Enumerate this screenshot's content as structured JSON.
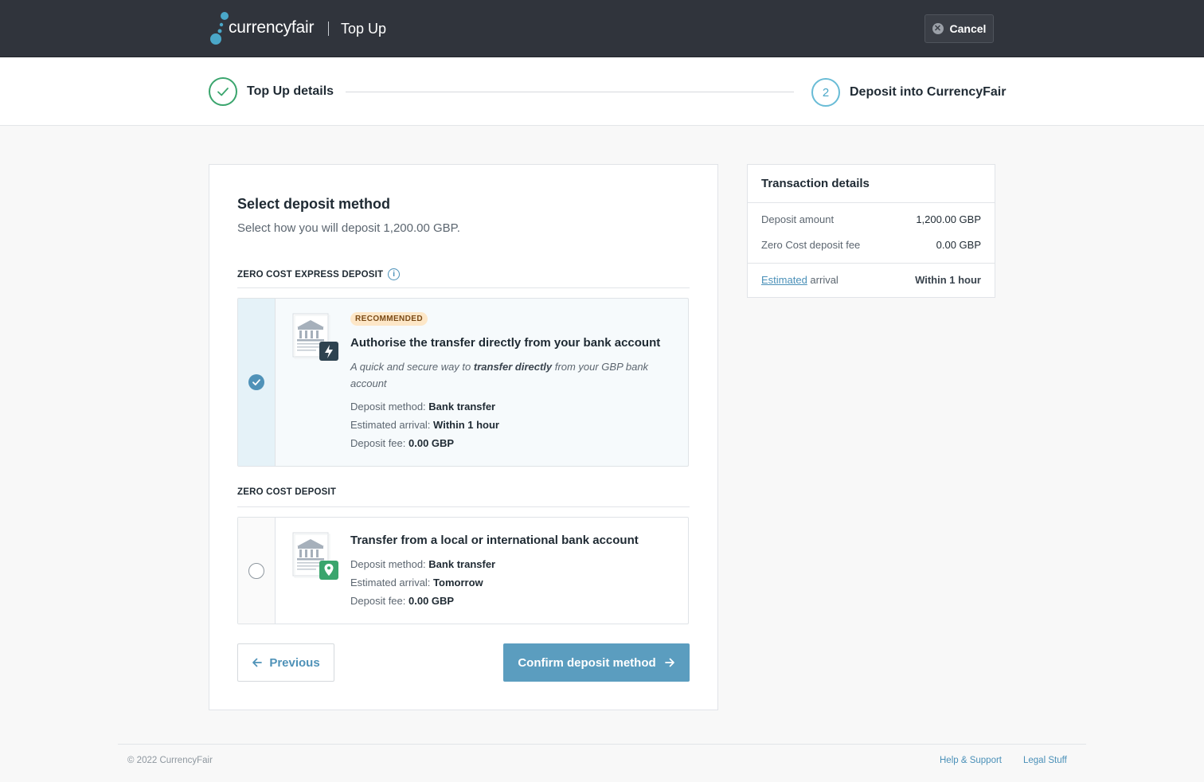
{
  "header": {
    "logo_text": "currencyfair",
    "app_title": "Top Up",
    "cancel_label": "Cancel"
  },
  "stepper": {
    "step1_label": "Top Up details",
    "step2_number": "2",
    "step2_label": "Deposit into CurrencyFair"
  },
  "main": {
    "title": "Select deposit method",
    "subtitle": "Select how you will deposit 1,200.00 GBP.",
    "sections": [
      {
        "heading": "ZERO COST EXPRESS DEPOSIT",
        "option": {
          "selected": true,
          "badge": "RECOMMENDED",
          "title": "Authorise the transfer directly from your bank account",
          "desc_prefix": "A quick and secure way to ",
          "desc_bold": "transfer directly",
          "desc_suffix": " from your GBP bank account",
          "method_label": "Deposit method:",
          "method_value": "Bank transfer",
          "arrival_label": "Estimated arrival:",
          "arrival_value": "Within 1 hour",
          "fee_label": "Deposit fee:",
          "fee_value": "0.00 GBP",
          "icon": "bank-lightning-icon"
        }
      },
      {
        "heading": "ZERO COST DEPOSIT",
        "option": {
          "selected": false,
          "title": "Transfer from a local or international bank account",
          "method_label": "Deposit method:",
          "method_value": "Bank transfer",
          "arrival_label": "Estimated arrival:",
          "arrival_value": "Tomorrow",
          "fee_label": "Deposit fee:",
          "fee_value": "0.00 GBP",
          "icon": "bank-location-icon"
        }
      }
    ],
    "previous_label": "Previous",
    "confirm_label": "Confirm deposit method"
  },
  "transaction": {
    "title": "Transaction details",
    "deposit_amount_label": "Deposit amount",
    "deposit_amount_value": "1,200.00 GBP",
    "fee_label": "Zero Cost deposit fee",
    "fee_value": "0.00 GBP",
    "arrival_link": "Estimated",
    "arrival_label_rest": " arrival",
    "arrival_value": "Within 1 hour"
  },
  "footer": {
    "copyright": "© 2022 CurrencyFair",
    "help_link": "Help & Support",
    "legal_link": "Legal Stuff"
  },
  "colors": {
    "topbar": "#30343c",
    "accent": "#5b9dbf",
    "success": "#3aa56d",
    "badge_bg": "#fde7c8"
  }
}
